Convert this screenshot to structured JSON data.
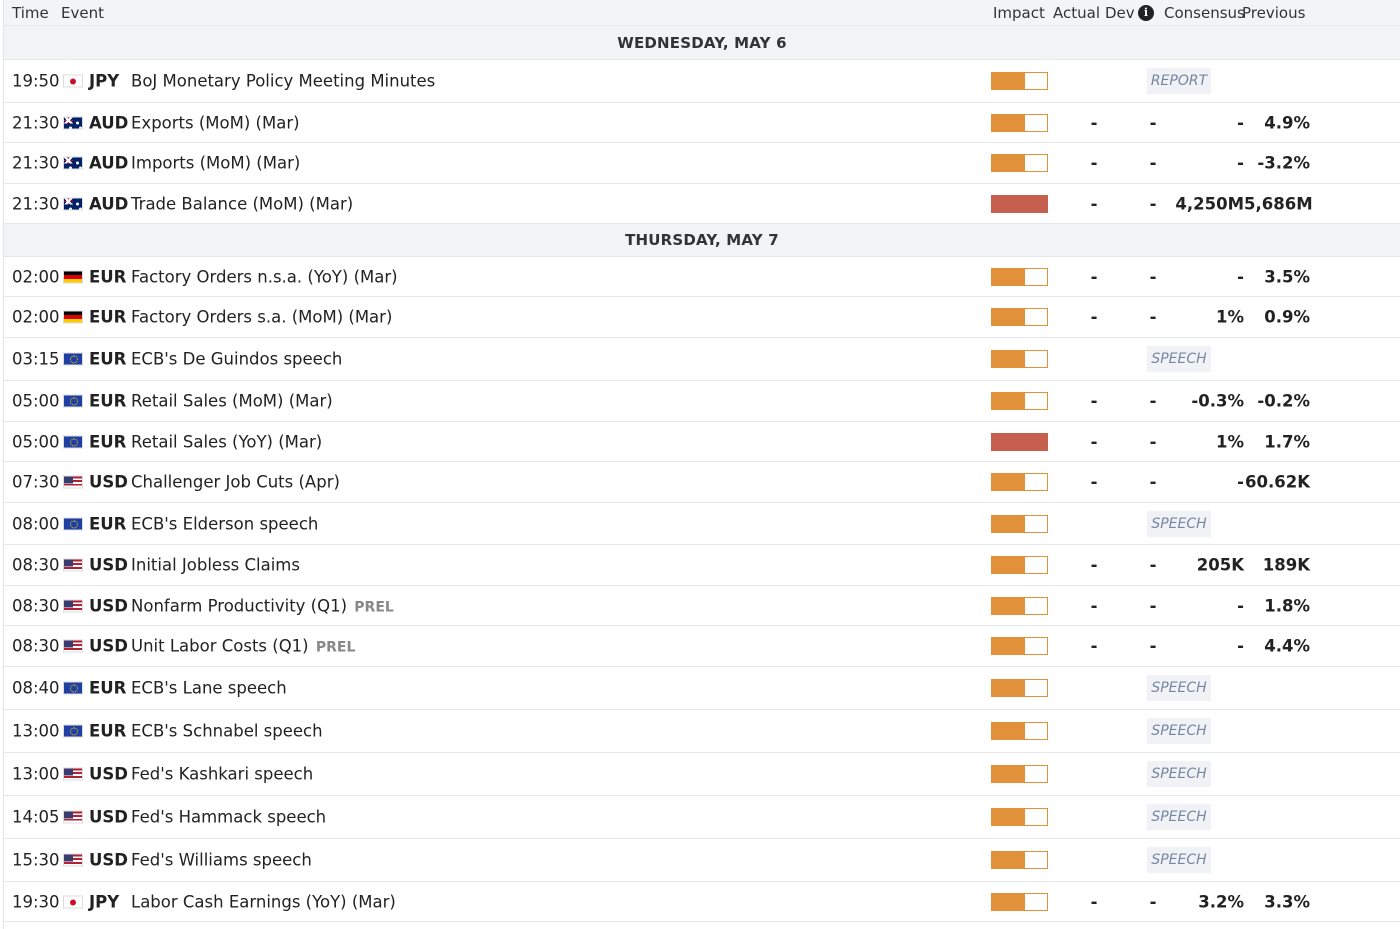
{
  "header": {
    "time": "Time",
    "event": "Event",
    "impact": "Impact",
    "actual": "Actual",
    "dev": "Dev",
    "consensus": "Consensus",
    "previous": "Previous"
  },
  "colors": {
    "impact_medium": "#e0913a",
    "impact_high": "#c65f4e",
    "badge_text": "#7587a3"
  },
  "days": [
    {
      "label": "WEDNESDAY, MAY 6",
      "events": [
        {
          "time": "19:50",
          "flag": "jp-flag-icon",
          "currency": "JPY",
          "event": "BoJ Monetary Policy Meeting Minutes",
          "tag": "",
          "impact": "medium",
          "actual": "",
          "dev": "",
          "consensus": "",
          "previous": "",
          "badge": "REPORT"
        },
        {
          "time": "21:30",
          "flag": "au-flag-icon",
          "currency": "AUD",
          "event": "Exports (MoM) (Mar)",
          "tag": "",
          "impact": "medium",
          "actual": "-",
          "dev": "-",
          "consensus": "-",
          "previous": "4.9%",
          "badge": ""
        },
        {
          "time": "21:30",
          "flag": "au-flag-icon",
          "currency": "AUD",
          "event": "Imports (MoM) (Mar)",
          "tag": "",
          "impact": "medium",
          "actual": "-",
          "dev": "-",
          "consensus": "-",
          "previous": "-3.2%",
          "badge": ""
        },
        {
          "time": "21:30",
          "flag": "au-flag-icon",
          "currency": "AUD",
          "event": "Trade Balance (MoM) (Mar)",
          "tag": "",
          "impact": "high",
          "actual": "-",
          "dev": "-",
          "consensus": "4,250M",
          "previous": "5,686M",
          "badge": ""
        }
      ]
    },
    {
      "label": "THURSDAY, MAY 7",
      "events": [
        {
          "time": "02:00",
          "flag": "de-flag-icon",
          "currency": "EUR",
          "event": "Factory Orders n.s.a. (YoY) (Mar)",
          "tag": "",
          "impact": "medium",
          "actual": "-",
          "dev": "-",
          "consensus": "-",
          "previous": "3.5%",
          "badge": ""
        },
        {
          "time": "02:00",
          "flag": "de-flag-icon",
          "currency": "EUR",
          "event": "Factory Orders s.a. (MoM) (Mar)",
          "tag": "",
          "impact": "medium",
          "actual": "-",
          "dev": "-",
          "consensus": "1%",
          "previous": "0.9%",
          "badge": ""
        },
        {
          "time": "03:15",
          "flag": "eu-flag-icon",
          "currency": "EUR",
          "event": "ECB's De Guindos speech",
          "tag": "",
          "impact": "medium",
          "actual": "",
          "dev": "",
          "consensus": "",
          "previous": "",
          "badge": "SPEECH"
        },
        {
          "time": "05:00",
          "flag": "eu-flag-icon",
          "currency": "EUR",
          "event": "Retail Sales (MoM) (Mar)",
          "tag": "",
          "impact": "medium",
          "actual": "-",
          "dev": "-",
          "consensus": "-0.3%",
          "previous": "-0.2%",
          "badge": ""
        },
        {
          "time": "05:00",
          "flag": "eu-flag-icon",
          "currency": "EUR",
          "event": "Retail Sales (YoY) (Mar)",
          "tag": "",
          "impact": "high",
          "actual": "-",
          "dev": "-",
          "consensus": "1%",
          "previous": "1.7%",
          "badge": ""
        },
        {
          "time": "07:30",
          "flag": "us-flag-icon",
          "currency": "USD",
          "event": "Challenger Job Cuts (Apr)",
          "tag": "",
          "impact": "medium",
          "actual": "-",
          "dev": "-",
          "consensus": "-",
          "previous": "60.62K",
          "badge": ""
        },
        {
          "time": "08:00",
          "flag": "eu-flag-icon",
          "currency": "EUR",
          "event": "ECB's Elderson speech",
          "tag": "",
          "impact": "medium",
          "actual": "",
          "dev": "",
          "consensus": "",
          "previous": "",
          "badge": "SPEECH"
        },
        {
          "time": "08:30",
          "flag": "us-flag-icon",
          "currency": "USD",
          "event": "Initial Jobless Claims",
          "tag": "",
          "impact": "medium",
          "actual": "-",
          "dev": "-",
          "consensus": "205K",
          "previous": "189K",
          "badge": ""
        },
        {
          "time": "08:30",
          "flag": "us-flag-icon",
          "currency": "USD",
          "event": "Nonfarm Productivity (Q1)",
          "tag": "PREL",
          "impact": "medium",
          "actual": "-",
          "dev": "-",
          "consensus": "-",
          "previous": "1.8%",
          "badge": ""
        },
        {
          "time": "08:30",
          "flag": "us-flag-icon",
          "currency": "USD",
          "event": "Unit Labor Costs (Q1)",
          "tag": "PREL",
          "impact": "medium",
          "actual": "-",
          "dev": "-",
          "consensus": "-",
          "previous": "4.4%",
          "badge": ""
        },
        {
          "time": "08:40",
          "flag": "eu-flag-icon",
          "currency": "EUR",
          "event": "ECB's Lane speech",
          "tag": "",
          "impact": "medium",
          "actual": "",
          "dev": "",
          "consensus": "",
          "previous": "",
          "badge": "SPEECH"
        },
        {
          "time": "13:00",
          "flag": "eu-flag-icon",
          "currency": "EUR",
          "event": "ECB's Schnabel speech",
          "tag": "",
          "impact": "medium",
          "actual": "",
          "dev": "",
          "consensus": "",
          "previous": "",
          "badge": "SPEECH"
        },
        {
          "time": "13:00",
          "flag": "us-flag-icon",
          "currency": "USD",
          "event": "Fed's Kashkari speech",
          "tag": "",
          "impact": "medium",
          "actual": "",
          "dev": "",
          "consensus": "",
          "previous": "",
          "badge": "SPEECH"
        },
        {
          "time": "14:05",
          "flag": "us-flag-icon",
          "currency": "USD",
          "event": "Fed's Hammack speech",
          "tag": "",
          "impact": "medium",
          "actual": "",
          "dev": "",
          "consensus": "",
          "previous": "",
          "badge": "SPEECH"
        },
        {
          "time": "15:30",
          "flag": "us-flag-icon",
          "currency": "USD",
          "event": "Fed's Williams speech",
          "tag": "",
          "impact": "medium",
          "actual": "",
          "dev": "",
          "consensus": "",
          "previous": "",
          "badge": "SPEECH"
        },
        {
          "time": "19:30",
          "flag": "jp-flag-icon",
          "currency": "JPY",
          "event": "Labor Cash Earnings (YoY) (Mar)",
          "tag": "",
          "impact": "medium",
          "actual": "-",
          "dev": "-",
          "consensus": "3.2%",
          "previous": "3.3%",
          "badge": ""
        }
      ]
    }
  ]
}
